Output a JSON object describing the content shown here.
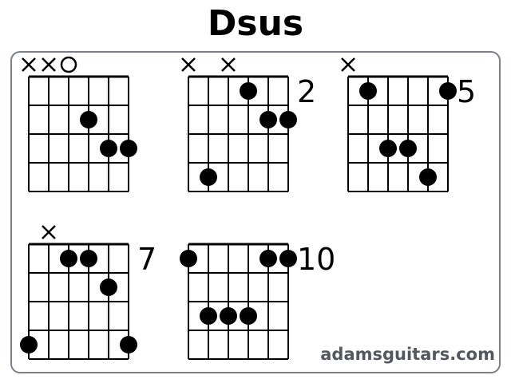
{
  "title": "Dsus",
  "watermark": "adamsguitars.com",
  "colors": {
    "ink": "#000000",
    "panel_border": "#7a7f88",
    "watermark": "#53575e"
  },
  "chords": [
    {
      "fret_label": "",
      "markers": [
        "x",
        "x",
        "o",
        "",
        "",
        ""
      ],
      "dots": [
        [
          4,
          2
        ],
        [
          5,
          3
        ],
        [
          6,
          3
        ]
      ]
    },
    {
      "fret_label": "2",
      "markers": [
        "x",
        "",
        "x",
        "",
        "",
        ""
      ],
      "dots": [
        [
          4,
          1
        ],
        [
          5,
          2
        ],
        [
          6,
          2
        ],
        [
          2,
          4
        ]
      ]
    },
    {
      "fret_label": "5",
      "markers": [
        "x",
        "",
        "",
        "",
        "",
        ""
      ],
      "dots": [
        [
          2,
          1
        ],
        [
          6,
          1
        ],
        [
          3,
          3
        ],
        [
          4,
          3
        ],
        [
          5,
          4
        ]
      ]
    },
    {
      "fret_label": "7",
      "markers": [
        "",
        "x",
        "",
        "",
        "",
        ""
      ],
      "dots": [
        [
          3,
          1
        ],
        [
          4,
          1
        ],
        [
          5,
          2
        ],
        [
          1,
          4
        ],
        [
          6,
          4
        ]
      ]
    },
    {
      "fret_label": "10",
      "markers": [
        "",
        "",
        "",
        "",
        "",
        ""
      ],
      "dots": [
        [
          1,
          1
        ],
        [
          5,
          1
        ],
        [
          6,
          1
        ],
        [
          2,
          3
        ],
        [
          3,
          3
        ],
        [
          4,
          3
        ]
      ]
    }
  ]
}
